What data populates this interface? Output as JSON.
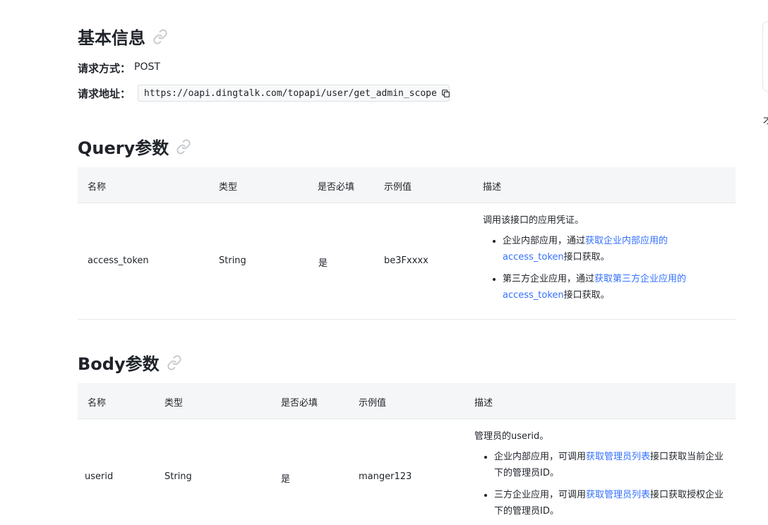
{
  "basic": {
    "title": "基本信息",
    "method_label": "请求方式：",
    "method_value": "POST",
    "url_label": "请求地址：",
    "url_value": "https://oapi.dingtalk.com/topapi/user/get_admin_scope"
  },
  "query": {
    "title": "Query参数",
    "headers": [
      "名称",
      "类型",
      "是否必填",
      "示例值",
      "描述"
    ],
    "row": {
      "name": "access_token",
      "type": "String",
      "required": "是",
      "example": "be3Fxxxx",
      "desc_intro": "调用该接口的应用凭证。",
      "b1_prefix": "企业内部应用，通过",
      "b1_link": "获取企业内部应用的access_token",
      "b1_suffix": "接口获取。",
      "b2_prefix": "第三方企业应用，通过",
      "b2_link": "获取第三方企业应用的access_token",
      "b2_suffix": "接口获取。"
    }
  },
  "body": {
    "title": "Body参数",
    "headers": [
      "名称",
      "类型",
      "是否必填",
      "示例值",
      "描述"
    ],
    "row": {
      "name": "userid",
      "type": "String",
      "required": "是",
      "example": "manger123",
      "desc_intro": "管理员的userid。",
      "b1_prefix": "企业内部应用，可调用",
      "b1_link": "获取管理员列表",
      "b1_suffix": "接口获取当前企业下的管理员ID。",
      "b2_prefix": "三方企业应用，可调用",
      "b2_link": "获取管理员列表",
      "b2_suffix": "接口获取授权企业下的管理员ID。"
    }
  },
  "edge_text": "才",
  "colors": {
    "link": "#3370ff",
    "table_header_bg": "#f5f6f7",
    "border": "#e4e6e8"
  },
  "icons": {
    "anchor": "link-icon",
    "copy": "copy-icon"
  }
}
